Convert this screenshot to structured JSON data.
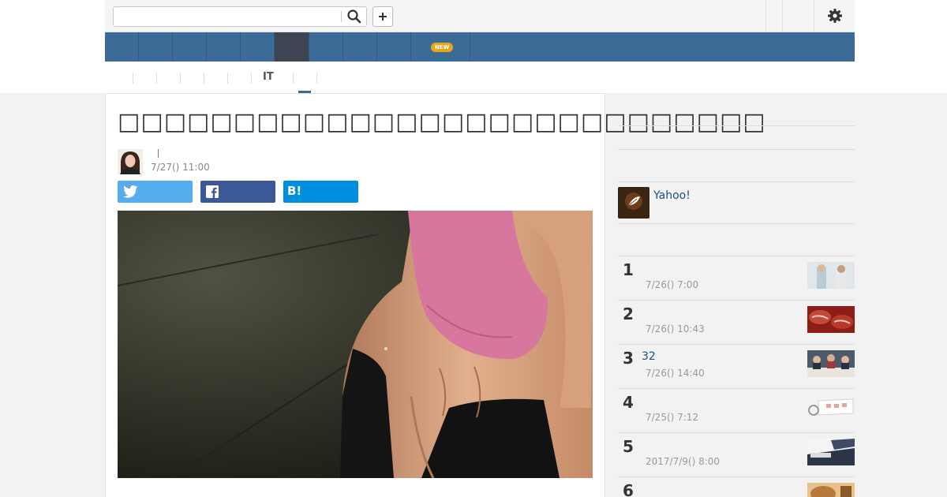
{
  "search": {
    "value": "",
    "placeholder": ""
  },
  "subnav": {
    "it_label": "IT"
  },
  "article": {
    "title": "□□□□□□□□□□□□□□□□□□□□□□□□□□□□",
    "date": "7/27() 11:00"
  },
  "share": {
    "hatena_label": "B!"
  },
  "badge": {
    "new": "NEW"
  },
  "sidebar": {
    "yahoo_label": "Yahoo!",
    "ranking": [
      {
        "rank": "1",
        "title": "",
        "date": "7/26() 7:00"
      },
      {
        "rank": "2",
        "title": "",
        "date": "7/26() 10:43"
      },
      {
        "rank": "3",
        "title": "32",
        "date": "7/26() 14:40"
      },
      {
        "rank": "4",
        "title": "",
        "date": "7/25() 7:12"
      },
      {
        "rank": "5",
        "title": "",
        "date": "2017/7/9() 8:00"
      },
      {
        "rank": "6",
        "title": "",
        "date": ""
      }
    ]
  },
  "colors": {
    "nav": "#3d6b97",
    "nav_active": "#3d4452",
    "twitter": "#55acee",
    "facebook": "#3b5998",
    "hatena": "#008fde",
    "link": "#1a4f8a",
    "new_badge": "#e6a817"
  },
  "icons": [
    "search-icon",
    "plus-icon",
    "gear-icon",
    "twitter-icon",
    "facebook-icon",
    "hatena-icon",
    "yahoo-feather-icon"
  ]
}
